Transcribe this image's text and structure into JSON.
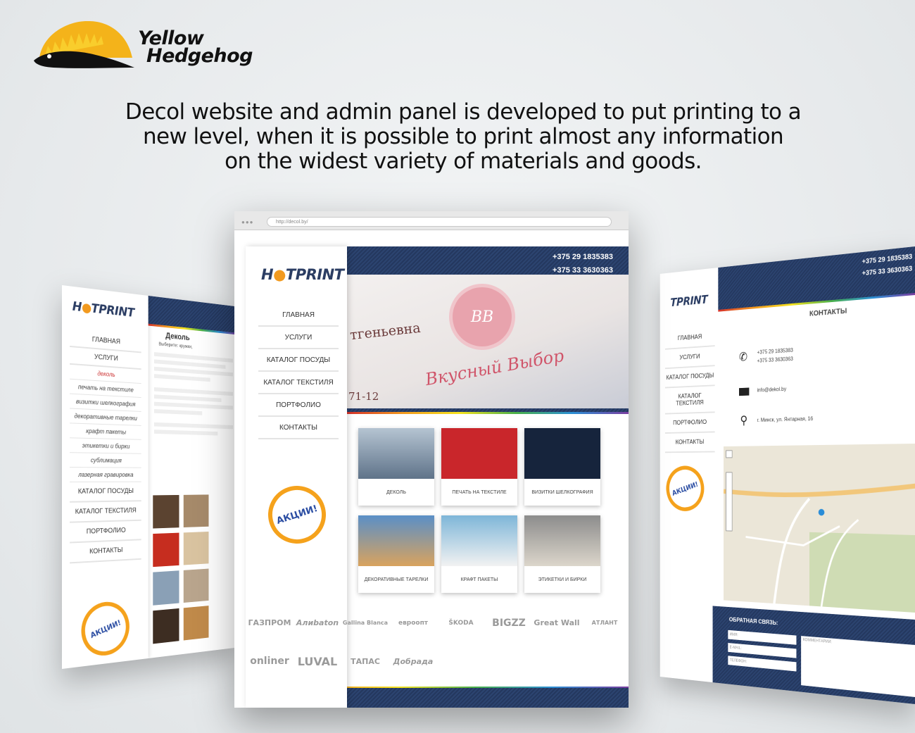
{
  "logo": {
    "line1": "Yellow",
    "line2": "Hedgehog"
  },
  "headline": {
    "line1": "Decol website and admin panel is developed to put printing to a",
    "line2": "new level, when it is possible to print almost any information",
    "line3": "on the widest variety of materials and goods."
  },
  "brand": {
    "name_a": "H",
    "name_b": "TPRINT"
  },
  "center": {
    "url": "http://decol.by/",
    "phone1": "+375 29 1835383",
    "phone2": "+375 33 3630363",
    "nav": [
      "ГЛАВНАЯ",
      "УСЛУГИ",
      "КАТАЛОГ ПОСУДЫ",
      "КАТАЛОГ ТЕКСТИЛЯ",
      "ПОРТФОЛИО",
      "КОНТАКТЫ"
    ],
    "promo": "АКЦИИ!",
    "cards": [
      "ДЕКОЛЬ",
      "ПЕЧАТЬ НА ТЕКСТИЛЕ",
      "ВИЗИТКИ ШЕЛКОГРАФИЯ",
      "ДЕКОРАТИВНЫЕ ТАРЕЛКИ",
      "КРАФТ ПАКЕТЫ",
      "ЭТИКЕТКИ И БИРКИ"
    ],
    "hero_text1": "Вкусный Выбор",
    "hero_text2": "тгеньевна",
    "hero_text3": "71-12",
    "brands": [
      "ГАЗПРОМ",
      "Алиbaton",
      "Gallina Blanca",
      "евроопт",
      "ŠKODA",
      "BIGZZ",
      "Great Wall",
      "АТЛАНТ",
      "onliner",
      "LUVAL",
      "ТАПАС",
      "Добрада"
    ]
  },
  "left": {
    "title": "Деколь",
    "subtitle": "Выберите: кружки,",
    "nav": [
      "ГЛАВНАЯ",
      "УСЛУГИ"
    ],
    "sub_nav": [
      "деколь",
      "печать на текстиле",
      "визитки шелкография",
      "декоративные тарелки",
      "крафт пакеты",
      "этикетки и бирки",
      "сублимация",
      "лазерная гравировка"
    ],
    "nav2": [
      "КАТАЛОГ ПОСУДЫ",
      "КАТАЛОГ ТЕКСТИЛЯ",
      "ПОРТФОЛИО",
      "КОНТАКТЫ"
    ],
    "promo": "АКЦИИ!"
  },
  "right": {
    "phone1": "+375 29 1835383",
    "phone2": "+375 33 3630363",
    "logo": "TPRINT",
    "heading": "КОНТАКТЫ",
    "contact_phone1": "+375 29 1835383",
    "contact_phone2": "+375 33 3630363",
    "email": "info@dekol.by",
    "address": "г. Минск, ул. Янтарная, 16",
    "nav": [
      "ГЛАВНАЯ",
      "УСЛУГИ",
      "КАТАЛОГ ПОСУДЫ",
      "КАТАЛОГ ТЕКСТИЛЯ",
      "ПОРТФОЛИО",
      "КОНТАКТЫ"
    ],
    "promo": "АКЦИИ!",
    "feedback": "ОБРАТНАЯ СВЯЗЬ:",
    "fields": [
      "ИМЯ:",
      "E-MAIL:",
      "ТЕЛЕФОН:"
    ],
    "comment": "КОММЕНТАРИИ:"
  }
}
